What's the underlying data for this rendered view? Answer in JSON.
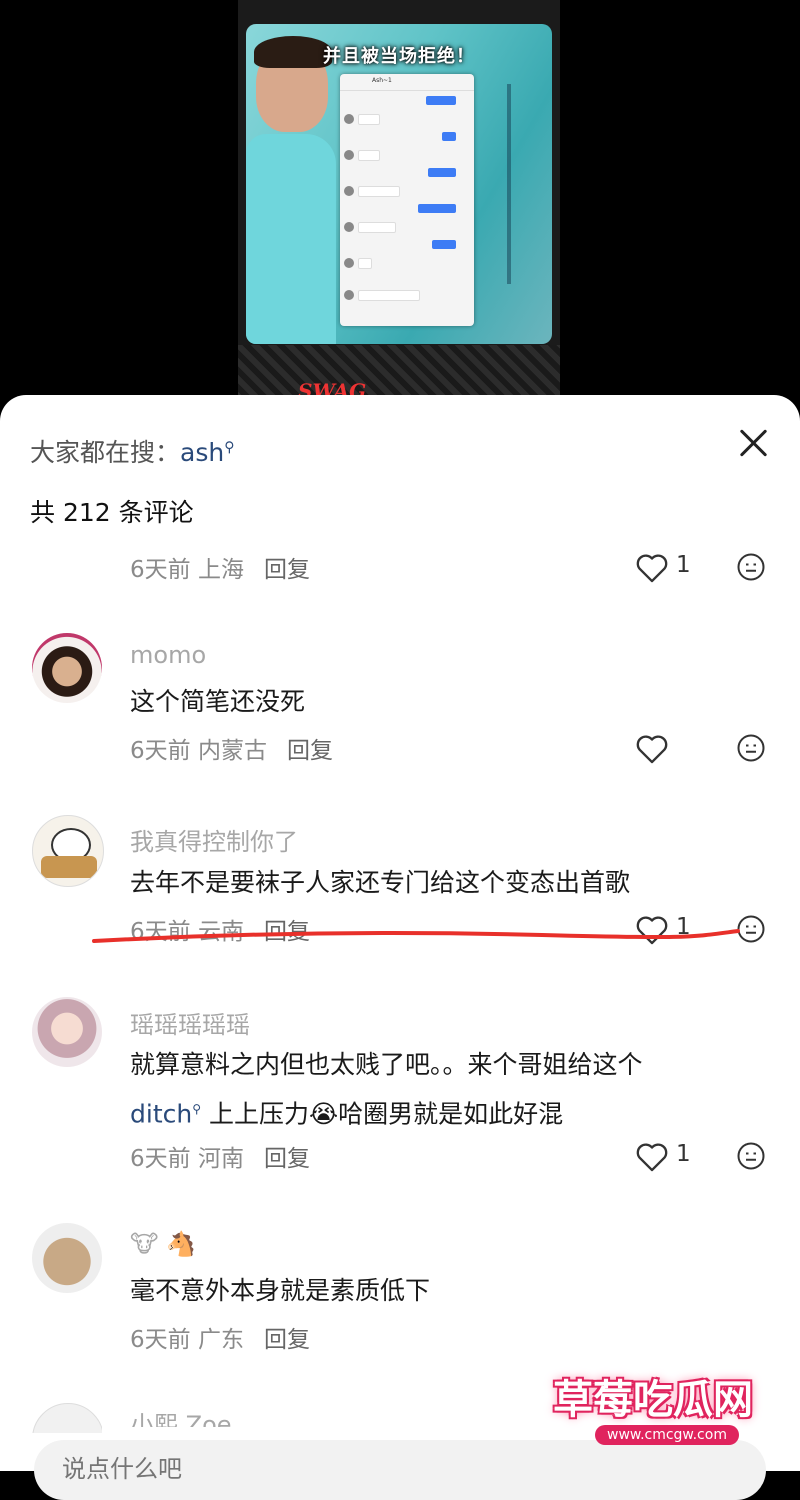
{
  "video": {
    "caption": "并且被当场拒绝！",
    "chat_header": "Ash~1",
    "brand": "SWAG"
  },
  "sheet": {
    "search_prefix": "大家都在搜：",
    "search_keyword": "ash",
    "comment_count": "共 212 条评论"
  },
  "comments": [
    {
      "meta_time": "6天前",
      "meta_place": "上海",
      "reply": "回复",
      "likes": "1"
    },
    {
      "username": "momo",
      "text": "这个简笔还没死",
      "meta_time": "6天前",
      "meta_place": "内蒙古",
      "reply": "回复",
      "likes": ""
    },
    {
      "username": "我真得控制你了",
      "text": "去年不是要袜子人家还专门给这个变态出首歌",
      "meta_time": "6天前",
      "meta_place": "云南",
      "reply": "回复",
      "likes": "1"
    },
    {
      "username": "瑶瑶瑶瑶瑶",
      "text_line1": "就算意料之内但也太贱了吧。。来个哥姐给这个",
      "text_link": "ditch",
      "text_line2": " 上上压力😭哈圈男就是如此好混",
      "meta_time": "6天前",
      "meta_place": "河南",
      "reply": "回复",
      "likes": "1"
    },
    {
      "username": "🐮 🐴",
      "text": "毫不意外本身就是素质低下",
      "meta_time": "6天前",
      "meta_place": "广东",
      "reply": "回复",
      "likes": ""
    }
  ],
  "partial_username": "小熙 Zoe",
  "input": {
    "placeholder": "说点什么吧"
  },
  "watermark": {
    "title": "草莓吃瓜网",
    "url": "www.cmcgw.com"
  },
  "colors": {
    "accent_red": "#e8302a",
    "link": "#2a4a7a",
    "meta_gray": "#8a8a8a"
  },
  "icons": [
    "close-icon",
    "heart-icon",
    "emoji-icon",
    "search-icon"
  ]
}
